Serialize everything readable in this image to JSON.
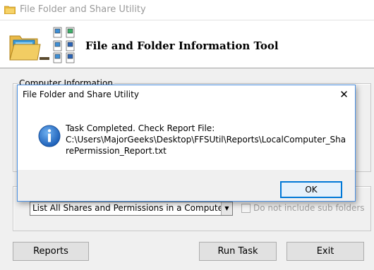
{
  "main_window": {
    "title": "File Folder and Share Utility",
    "banner_title": "File and Folder Information Tool",
    "group_computer_title": "Computer Information",
    "operation_select": {
      "selected": "List All Shares and Permissions in a Computer"
    },
    "exclude_subfolders_label": "Do not include sub folders",
    "buttons": {
      "reports": "Reports",
      "run_task": "Run Task",
      "exit": "Exit"
    }
  },
  "dialog": {
    "title": "File Folder and Share Utility",
    "close_glyph": "✕",
    "message_line1": "Task Completed. Check Report File:",
    "message_path": "C:\\Users\\MajorGeeks\\Desktop\\FFSUtil\\Reports\\LocalComputer_SharePermission_Report.txt",
    "ok_label": "OK",
    "icon": "info-icon"
  },
  "colors": {
    "dialog_border": "#4a90e2",
    "info_blue": "#1c5fb8",
    "ok_focus": "#0078d7"
  }
}
